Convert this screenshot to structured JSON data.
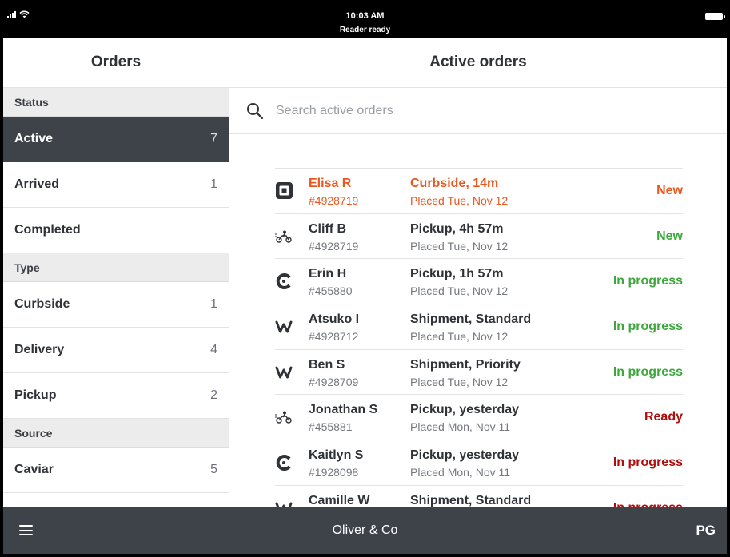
{
  "status_bar": {
    "time": "10:03 AM",
    "reader": "Reader ready"
  },
  "sidebar": {
    "title": "Orders",
    "sections": [
      {
        "heading": "Status",
        "items": [
          {
            "label": "Active",
            "count": "7",
            "selected": true
          },
          {
            "label": "Arrived",
            "count": "1"
          },
          {
            "label": "Completed",
            "count": ""
          }
        ]
      },
      {
        "heading": "Type",
        "items": [
          {
            "label": "Curbside",
            "count": "1"
          },
          {
            "label": "Delivery",
            "count": "4"
          },
          {
            "label": "Pickup",
            "count": "2"
          }
        ]
      },
      {
        "heading": "Source",
        "items": [
          {
            "label": "Caviar",
            "count": "5"
          }
        ]
      }
    ]
  },
  "main": {
    "title": "Active orders",
    "search_placeholder": "Search active orders",
    "orders": [
      {
        "icon": "square-logo-icon",
        "name": "Elisa R",
        "number": "#4928719",
        "type": "Curbside, 14m",
        "placed": "Placed Tue, Nov 12",
        "status": "New",
        "alert": true
      },
      {
        "icon": "postmates-courier-icon",
        "name": "Cliff B",
        "number": "#4928719",
        "type": "Pickup, 4h 57m",
        "placed": "Placed Tue, Nov 12",
        "status": "New"
      },
      {
        "icon": "caviar-logo-icon",
        "name": "Erin H",
        "number": "#455880",
        "type": "Pickup, 1h 57m",
        "placed": "Placed Tue, Nov 12",
        "status": "In progress"
      },
      {
        "icon": "weebly-logo-icon",
        "name": "Atsuko I",
        "number": "#4928712",
        "type": "Shipment, Standard",
        "placed": "Placed Tue, Nov 12",
        "status": "In progress"
      },
      {
        "icon": "weebly-logo-icon",
        "name": "Ben S",
        "number": "#4928709",
        "type": "Shipment, Priority",
        "placed": "Placed Tue, Nov 12",
        "status": "In progress"
      },
      {
        "icon": "postmates-courier-icon",
        "name": "Jonathan S",
        "number": "#455881",
        "type": "Pickup, yesterday",
        "placed": "Placed Mon, Nov 11",
        "status": "Ready"
      },
      {
        "icon": "caviar-logo-icon",
        "name": "Kaitlyn S",
        "number": "#1928098",
        "type": "Pickup, yesterday",
        "placed": "Placed Mon, Nov 11",
        "status": "In progress"
      },
      {
        "icon": "weebly-logo-icon",
        "name": "Camille W",
        "number": "",
        "type": "Shipment, Standard",
        "placed": "",
        "status": "In progress"
      }
    ]
  },
  "bottom_bar": {
    "business_name": "Oliver & Co",
    "user_initials": "PG"
  },
  "colors": {
    "dark": "#3d4348",
    "alert_orange": "#e8581f",
    "green": "#3ca83c",
    "red": "#b00d0d"
  }
}
